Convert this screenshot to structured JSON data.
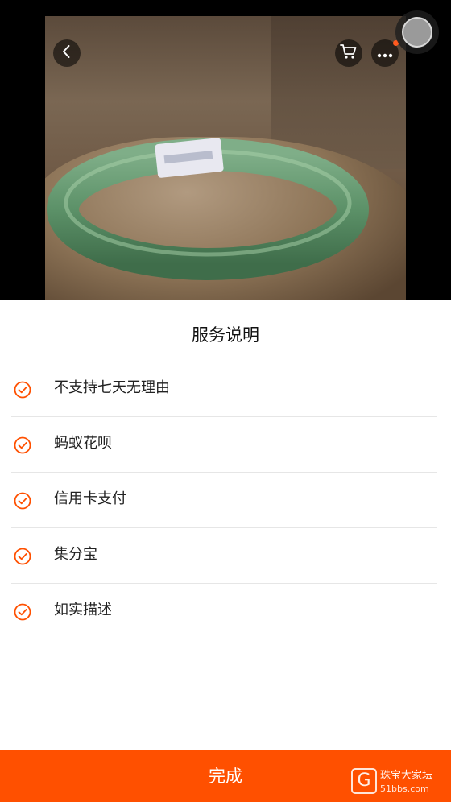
{
  "header": {
    "overlay_text": "",
    "icons": {
      "back": "chevron-left-icon",
      "cart": "cart-icon",
      "more": "more-dots-icon"
    }
  },
  "sheet": {
    "title": "服务说明",
    "items": [
      {
        "label": "不支持七天无理由",
        "icon": "check-circle-icon"
      },
      {
        "label": "蚂蚁花呗",
        "icon": "check-circle-icon"
      },
      {
        "label": "信用卡支付",
        "icon": "check-circle-icon"
      },
      {
        "label": "集分宝",
        "icon": "check-circle-icon"
      },
      {
        "label": "如实描述",
        "icon": "check-circle-icon"
      }
    ]
  },
  "footer": {
    "done_label": "完成"
  },
  "watermark": {
    "brand": "珠宝大家坛",
    "url": "51bbs.com",
    "letter": "G"
  },
  "colors": {
    "accent": "#ff5000",
    "check": "#ff5000",
    "sheet_bg": "#ffffff",
    "divider": "#e6e6e6"
  }
}
